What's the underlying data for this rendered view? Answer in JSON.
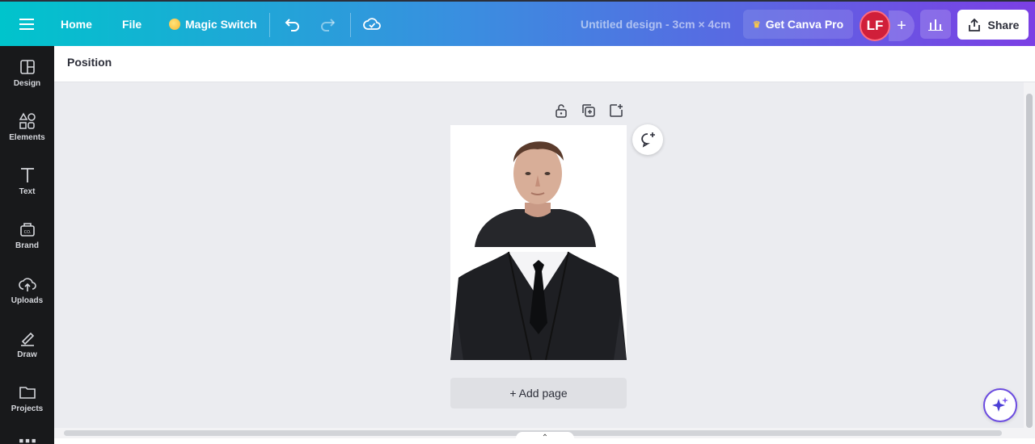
{
  "topbar": {
    "menu_icon": "hamburger-icon",
    "home": "Home",
    "file": "File",
    "magic_switch": "Magic Switch",
    "undo_icon": "undo-icon",
    "redo_icon": "redo-icon",
    "save_status_icon": "cloud-check-icon",
    "doc_title": "Untitled design - 3cm × 4cm",
    "get_pro": "Get Canva Pro",
    "avatar_initials": "LF",
    "share": "Share"
  },
  "sidebar": {
    "items": [
      {
        "label": "Design",
        "icon": "layout-icon"
      },
      {
        "label": "Elements",
        "icon": "shapes-icon"
      },
      {
        "label": "Text",
        "icon": "text-icon"
      },
      {
        "label": "Brand",
        "icon": "brand-icon"
      },
      {
        "label": "Uploads",
        "icon": "upload-cloud-icon"
      },
      {
        "label": "Draw",
        "icon": "pen-icon"
      },
      {
        "label": "Projects",
        "icon": "folder-icon"
      }
    ]
  },
  "contextbar": {
    "position": "Position"
  },
  "canvas": {
    "add_page": "+ Add page",
    "page_content": [
      "portrait-photo",
      "suit-photo"
    ]
  },
  "colors": {
    "gradient_start": "#00c4cc",
    "gradient_end": "#7b3fe4",
    "rail_bg": "#18191b",
    "avatar_bg": "#d01f3a"
  }
}
